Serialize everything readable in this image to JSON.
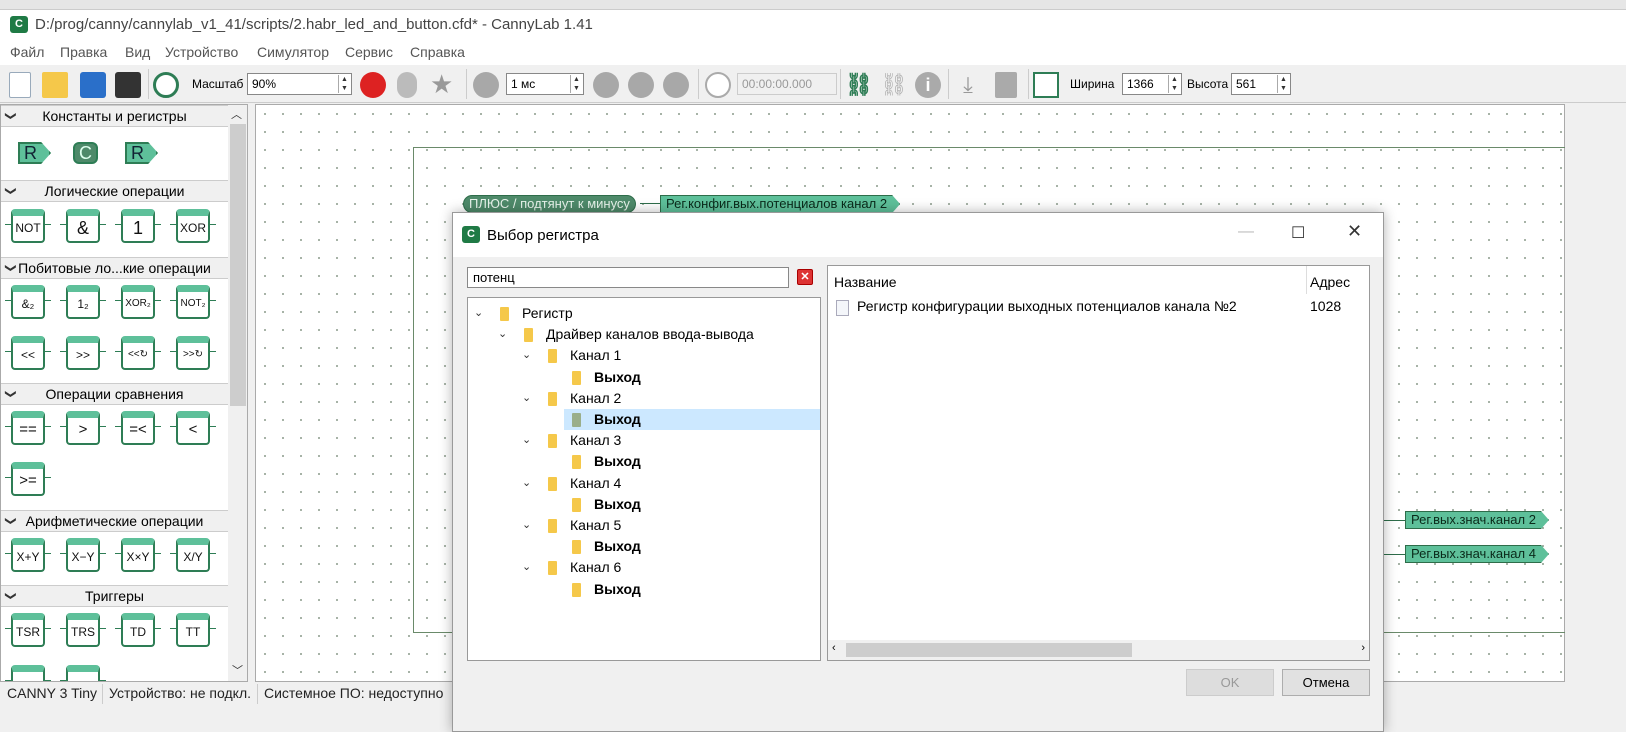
{
  "window": {
    "title": "D:/prog/canny/cannylab_v1_41/scripts/2.habr_led_and_button.cfd* - CannyLab 1.41",
    "icon": "cannylab-logo-icon"
  },
  "menu": [
    "Файл",
    "Правка",
    "Вид",
    "Устройство",
    "Симулятор",
    "Сервис",
    "Справка"
  ],
  "toolbar": {
    "zoom_label": "Масштаб",
    "zoom_value": "90%",
    "step_value": "1 мс",
    "timer_value": "00:00:00.000",
    "width_label": "Ширина",
    "width_value": "1366",
    "height_label": "Высота",
    "height_value": "561"
  },
  "palette": {
    "sections": [
      {
        "title": "Константы и регистры",
        "items": [
          "R",
          "C",
          "R"
        ]
      },
      {
        "title": "Логические операции",
        "items": [
          "NOT",
          "&",
          "1",
          "XOR"
        ]
      },
      {
        "title": "Побитовые ло...кие операции",
        "items": [
          "&₂",
          "1₂",
          "XOR₂",
          "NOT₂",
          "<<",
          ">>",
          "<<↻",
          ">>↻"
        ]
      },
      {
        "title": "Операции сравнения",
        "items": [
          "==",
          ">",
          "=<",
          "<",
          ">="
        ]
      },
      {
        "title": "Арифметические операции",
        "items": [
          "X+Y",
          "X−Y",
          "X×Y",
          "X/Y"
        ]
      },
      {
        "title": "Триггеры",
        "items": [
          "TSR",
          "TRS",
          "TD",
          "TT"
        ]
      }
    ]
  },
  "canvas": {
    "labels": [
      "ПЛЮС / подтянут к минусу",
      "Рег.конфиг.вых.потенциалов канал 2",
      "Рег.вых.знач.канал 2",
      "Рег.вых.знач.канал 4"
    ]
  },
  "status": [
    "CANNY 3 Tiny",
    "Устройство: не подкл.",
    "Системное ПО: недоступно"
  ],
  "dialog": {
    "title": "Выбор регистра",
    "search_value": "потенц",
    "tree": [
      {
        "label": "Регистр",
        "level": 0
      },
      {
        "label": "Драйвер каналов ввода-вывода",
        "level": 1
      },
      {
        "label": "Канал 1",
        "level": 2
      },
      {
        "label": "Выход",
        "level": 3
      },
      {
        "label": "Канал 2",
        "level": 2
      },
      {
        "label": "Выход",
        "level": 3,
        "selected": true
      },
      {
        "label": "Канал 3",
        "level": 2
      },
      {
        "label": "Выход",
        "level": 3
      },
      {
        "label": "Канал 4",
        "level": 2
      },
      {
        "label": "Выход",
        "level": 3
      },
      {
        "label": "Канал 5",
        "level": 2
      },
      {
        "label": "Выход",
        "level": 3
      },
      {
        "label": "Канал 6",
        "level": 2
      },
      {
        "label": "Выход",
        "level": 3
      }
    ],
    "list": {
      "columns": [
        "Название",
        "Адрес"
      ],
      "rows": [
        {
          "name": "Регистр конфигурации выходных потенциалов канала №2",
          "address": "1028"
        }
      ]
    },
    "ok_label": "OK",
    "cancel_label": "Отмена"
  },
  "colors": {
    "accent": "#2e7d55",
    "block_fill": "#5ec09a",
    "selection": "#cce8ff"
  }
}
